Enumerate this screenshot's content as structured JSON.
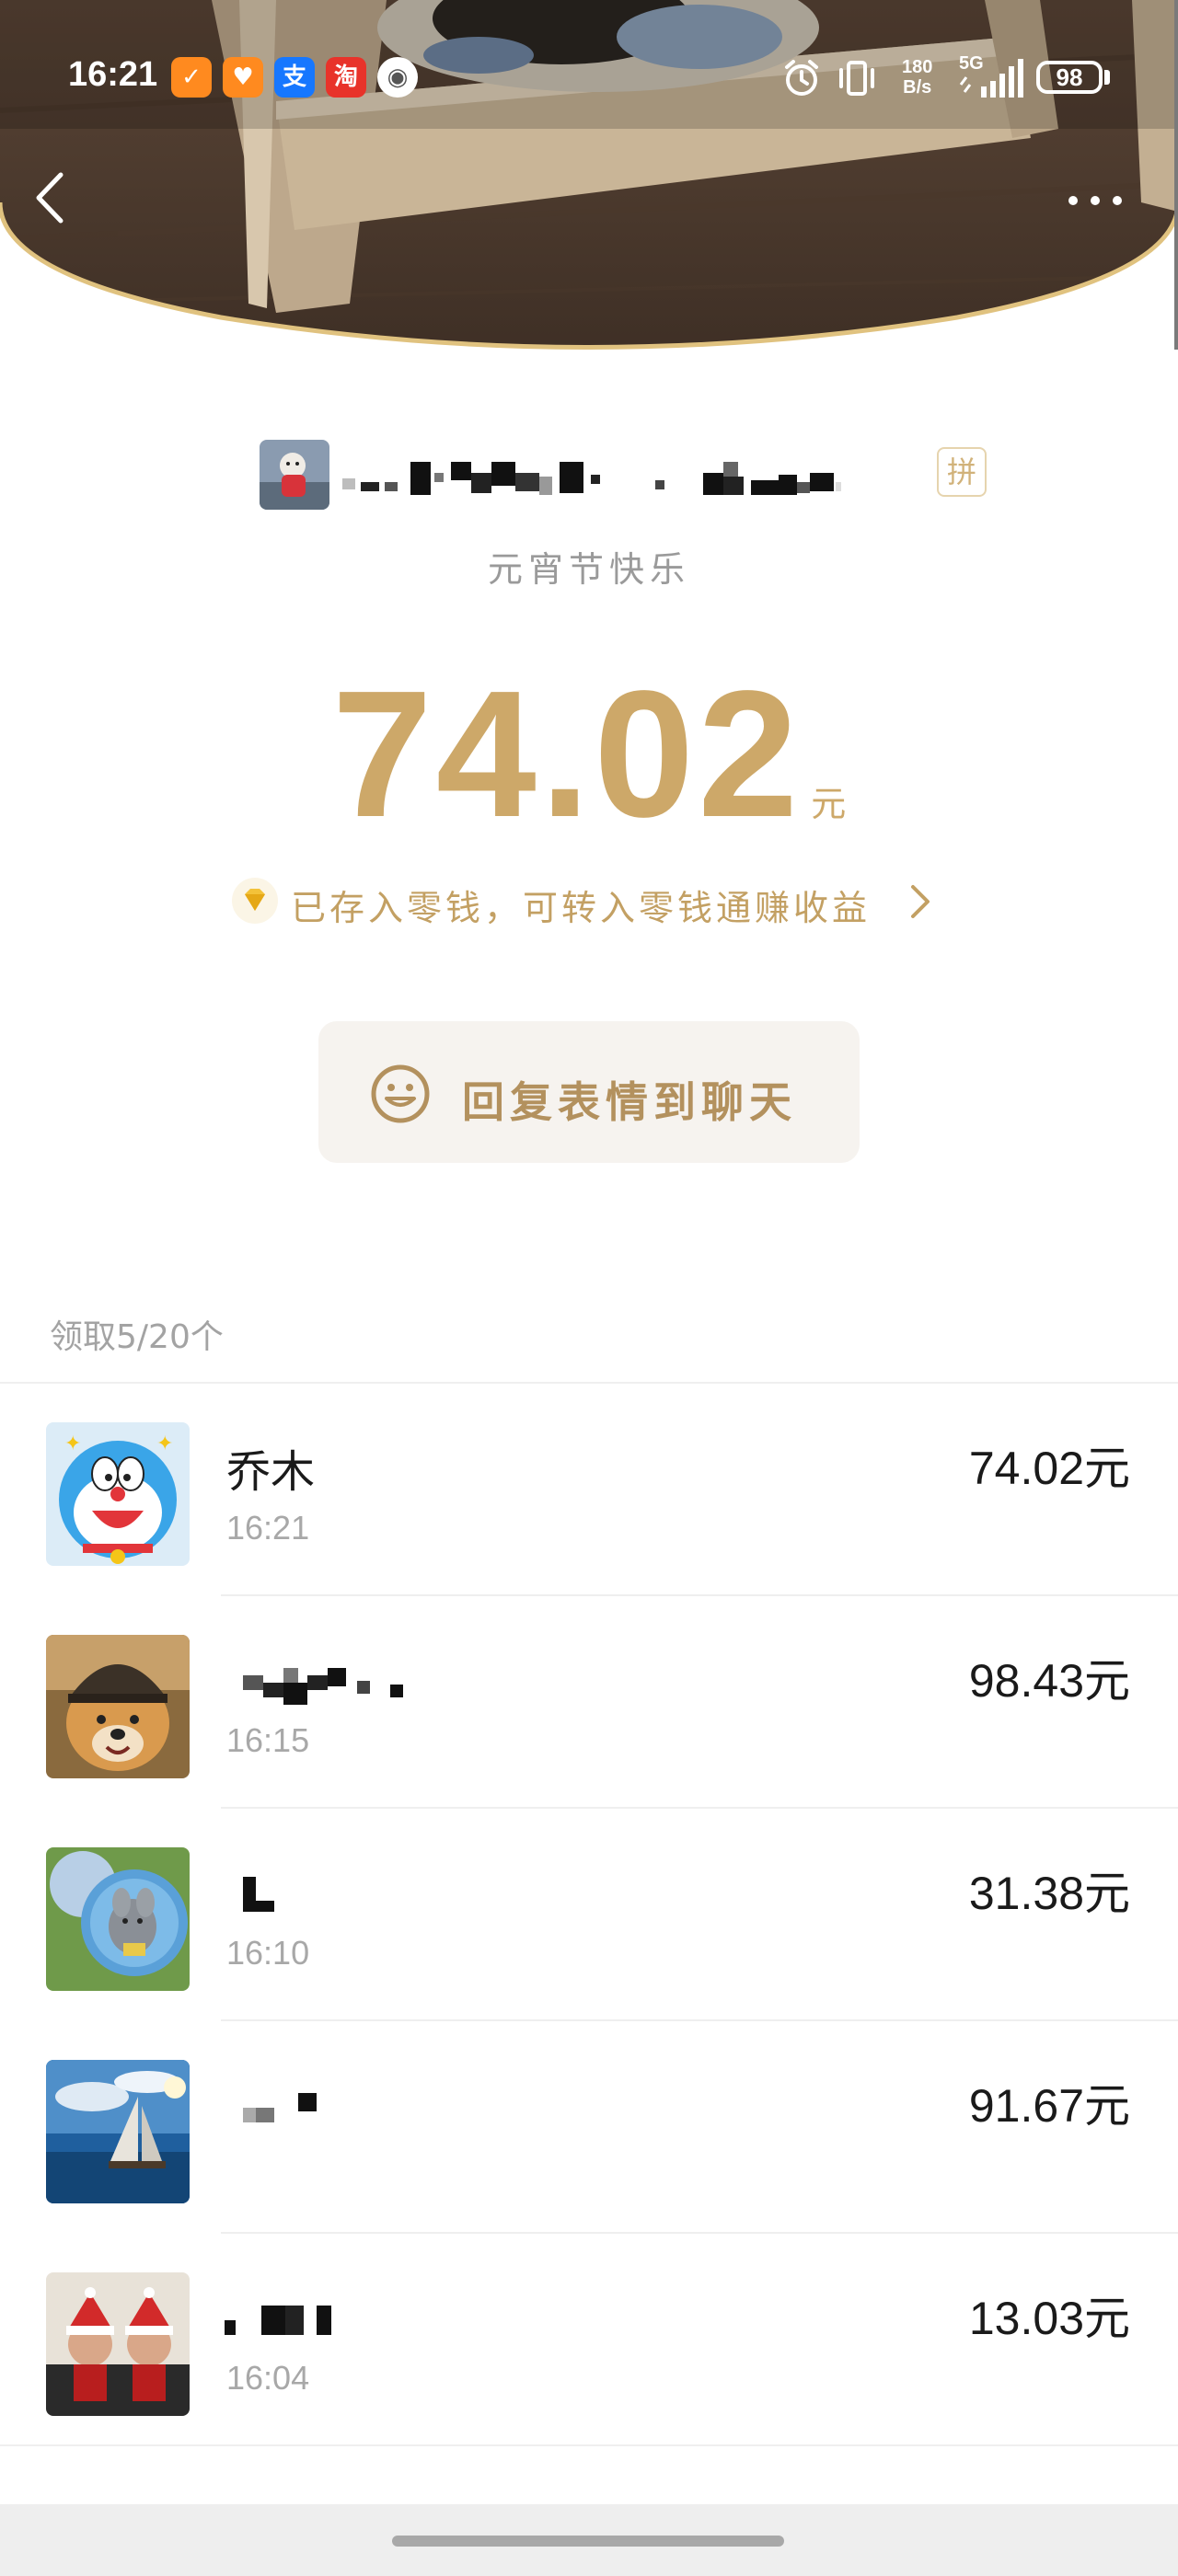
{
  "status_bar": {
    "time": "16:21",
    "net_speed_value": "180",
    "net_speed_unit": "B/s",
    "network": "5G",
    "battery": "98",
    "apps": [
      {
        "name": "app-1-icon",
        "glyph": "✓",
        "color": "#ff8a1f"
      },
      {
        "name": "app-2-icon",
        "glyph": "♥",
        "color": "#ff8a1f"
      },
      {
        "name": "alipay-icon",
        "glyph": "支",
        "color": "#1677ff"
      },
      {
        "name": "taobao-icon",
        "glyph": "淘",
        "color": "#e8332a"
      },
      {
        "name": "audio-icon",
        "glyph": "◉",
        "color": "#ffffff"
      }
    ]
  },
  "envelope": {
    "greeting": "元宵节快乐",
    "pin_tag": "拼",
    "amount": "74.02",
    "unit": "元",
    "stored_note": "已存入零钱，可转入零钱通赚收益"
  },
  "reply": {
    "label": "回复表情到聊天"
  },
  "claimed": {
    "header": "领取5/20个",
    "rows": [
      {
        "name": "乔木",
        "time": "16:21",
        "amount": "74.02元"
      },
      {
        "name": "",
        "time": "16:15",
        "amount": "98.43元"
      },
      {
        "name": "",
        "time": "16:10",
        "amount": "31.38元"
      },
      {
        "name": "",
        "time": "",
        "amount": "91.67元"
      },
      {
        "name": "",
        "time": "16:04",
        "amount": "13.03元"
      }
    ]
  },
  "colors": {
    "gold": "#cda869",
    "gold_text": "#c3a063",
    "reply_bg": "#f6f3ef"
  }
}
